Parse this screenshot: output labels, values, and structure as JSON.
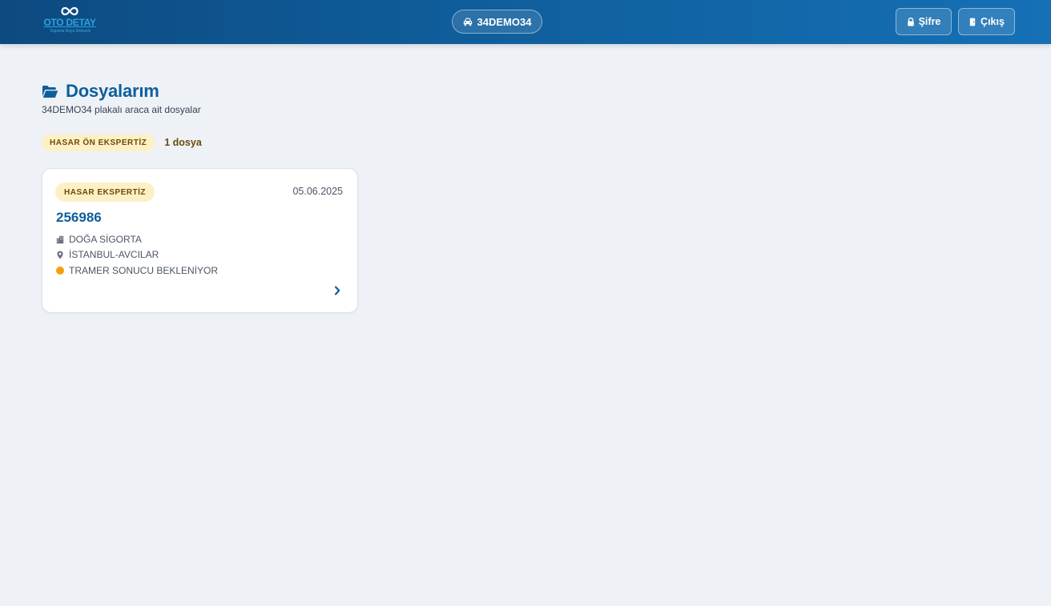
{
  "header": {
    "logo_text": "OTO DETAY",
    "logo_subtext": "Kaporta Boya Mekanik",
    "plate": "34DEMO34",
    "password_label": "Şifre",
    "logout_label": "Çıkış",
    "icons": {
      "logo": "infinity-logo-icon",
      "plate": "car-icon",
      "password": "lock-icon",
      "logout": "door-icon"
    }
  },
  "page": {
    "title": "Dosyalarım",
    "title_icon": "folder-open-icon",
    "subtitle": "34DEMO34 plakalı araca ait dosyalar"
  },
  "filter": {
    "category": "HASAR ÖN EKSPERTİZ",
    "count": "1 dosya"
  },
  "files": [
    {
      "type": "HASAR EKSPERTİZ",
      "date": "05.06.2025",
      "number": "256986",
      "company": "DOĞA SİGORTA",
      "company_icon": "building-icon",
      "location": "İSTANBUL-AVCILAR",
      "location_icon": "map-pin-icon",
      "status": "TRAMER SONUCU BEKLENİYOR",
      "status_color": "#f59e0b",
      "action_icon": "chevron-right-icon"
    }
  ],
  "colors": {
    "header_from": "#0d4a80",
    "header_to": "#1570b5",
    "accent": "#0f5e9c",
    "badge_bg": "#fdf0c4",
    "badge_text": "#6b4b0a",
    "page_bg": "#eef2f7"
  }
}
